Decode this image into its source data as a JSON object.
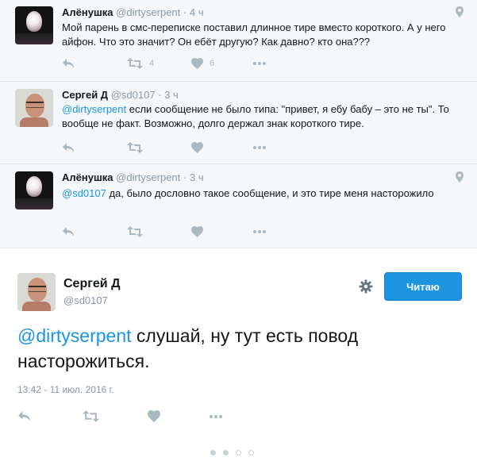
{
  "replies": [
    {
      "name": "Алёнушка",
      "handle": "@dirtyserpent",
      "time": "· 4 ч",
      "mention": "",
      "text": "Мой парень в смс-переписке поставил длинное тире вместо короткого. А у него айфон. Что это значит? Он ебёт другую? Как давно? кто она???",
      "retweets": "4",
      "likes": "6"
    },
    {
      "name": "Сергей Д",
      "handle": "@sd0107",
      "time": "· 3 ч",
      "mention": "@dirtyserpent",
      "text": " если сообщение не было типа: \"привет, я ебу бабу – это не ты\". То вообще не факт. Возможно, долго держал знак короткого тире.",
      "retweets": "",
      "likes": ""
    },
    {
      "name": "Алёнушка",
      "handle": "@dirtyserpent",
      "time": "· 3 ч",
      "mention": "@sd0107",
      "text": " да, было дословно такое сообщение, и это тире меня насторожило",
      "retweets": "",
      "likes": ""
    }
  ],
  "main": {
    "name": "Сергей Д",
    "handle": "@sd0107",
    "follow_label": "Читаю",
    "mention": "@dirtyserpent",
    "text": " слушай, ну тут есть повод насторожиться.",
    "timestamp": "13:42 - 11 июл. 2016 г."
  },
  "icons": [
    "reply-icon",
    "retweet-icon",
    "like-icon",
    "more-icon",
    "location-icon",
    "gear-icon"
  ],
  "colors": {
    "accent": "#1b95e0",
    "muted": "#aab8c2",
    "reply_bg": "#f5f8fa"
  }
}
